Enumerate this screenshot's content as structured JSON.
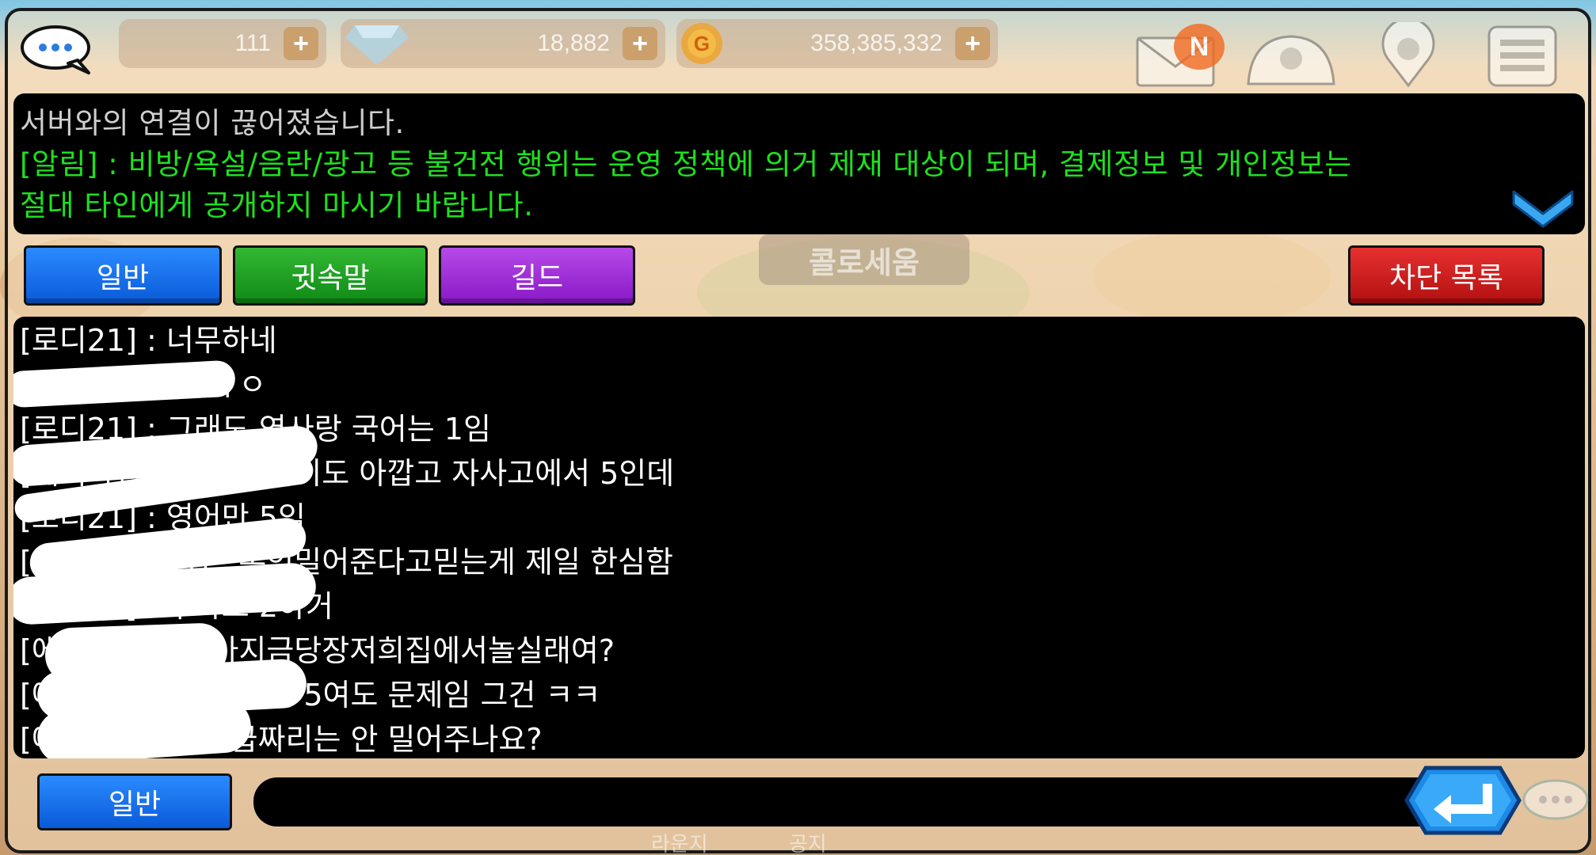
{
  "topbar": {
    "resources": [
      {
        "name": "stamina",
        "value": "111"
      },
      {
        "name": "gems",
        "value": "18,882"
      },
      {
        "name": "gold",
        "value": "358,385,332"
      }
    ],
    "plus_symbol": "+",
    "mail_badge": "N"
  },
  "notice": {
    "system_message": "서버와의 연결이 끊어졌습니다.",
    "alert_line1": "[알림] : 비방/욕설/음란/광고 등 불건전 행위는 운영 정책에 의거 제재 대상이 되며, 결제정보 및 개인정보는",
    "alert_line2": "절대 타인에게 공개하지 마시기 바랍니다."
  },
  "tabs": {
    "general": "일반",
    "whisper": "귓속말",
    "guild": "길드",
    "block_list": "차단 목록"
  },
  "background_label": "콜로세움",
  "chat": [
    {
      "text": "[로디21] : 너무하네"
    },
    {
      "text": "[에서라인짱] : ㅓㅇ"
    },
    {
      "text": "[로디21] : 그래도 역사랑 국어는 1임"
    },
    {
      "text": "[에서라인짱짱] : 입학비도 아깝고 자사고에서 5인데"
    },
    {
      "text": "[로디21] : 영어만 5임"
    },
    {
      "text": "[에서라인짱짱] : 본인밀어준다고믿는게 제일 한심함"
    },
    {
      "text": "[로디21] : 수학도 2하거"
    },
    {
      "text": "[에서라] : 님들아지금당장저희집에서놀실래여?"
    },
    {
      "text": "[에서라인짱] : 영어만 5여도 문제임 그건 ㅋㅋ"
    },
    {
      "text": "[에서라인] : 1등급짜리는 안 밀어주나요?"
    }
  ],
  "input": {
    "channel": "일반",
    "value": ""
  },
  "bottom": {
    "lounge": "라운지",
    "notice": "공지"
  },
  "colors": {
    "general_tab": "#1a6ff0",
    "whisper_tab": "#1c9a1c",
    "guild_tab": "#9a2ad8",
    "block_tab": "#cc1c1c",
    "alert_text": "#1ee01e"
  }
}
